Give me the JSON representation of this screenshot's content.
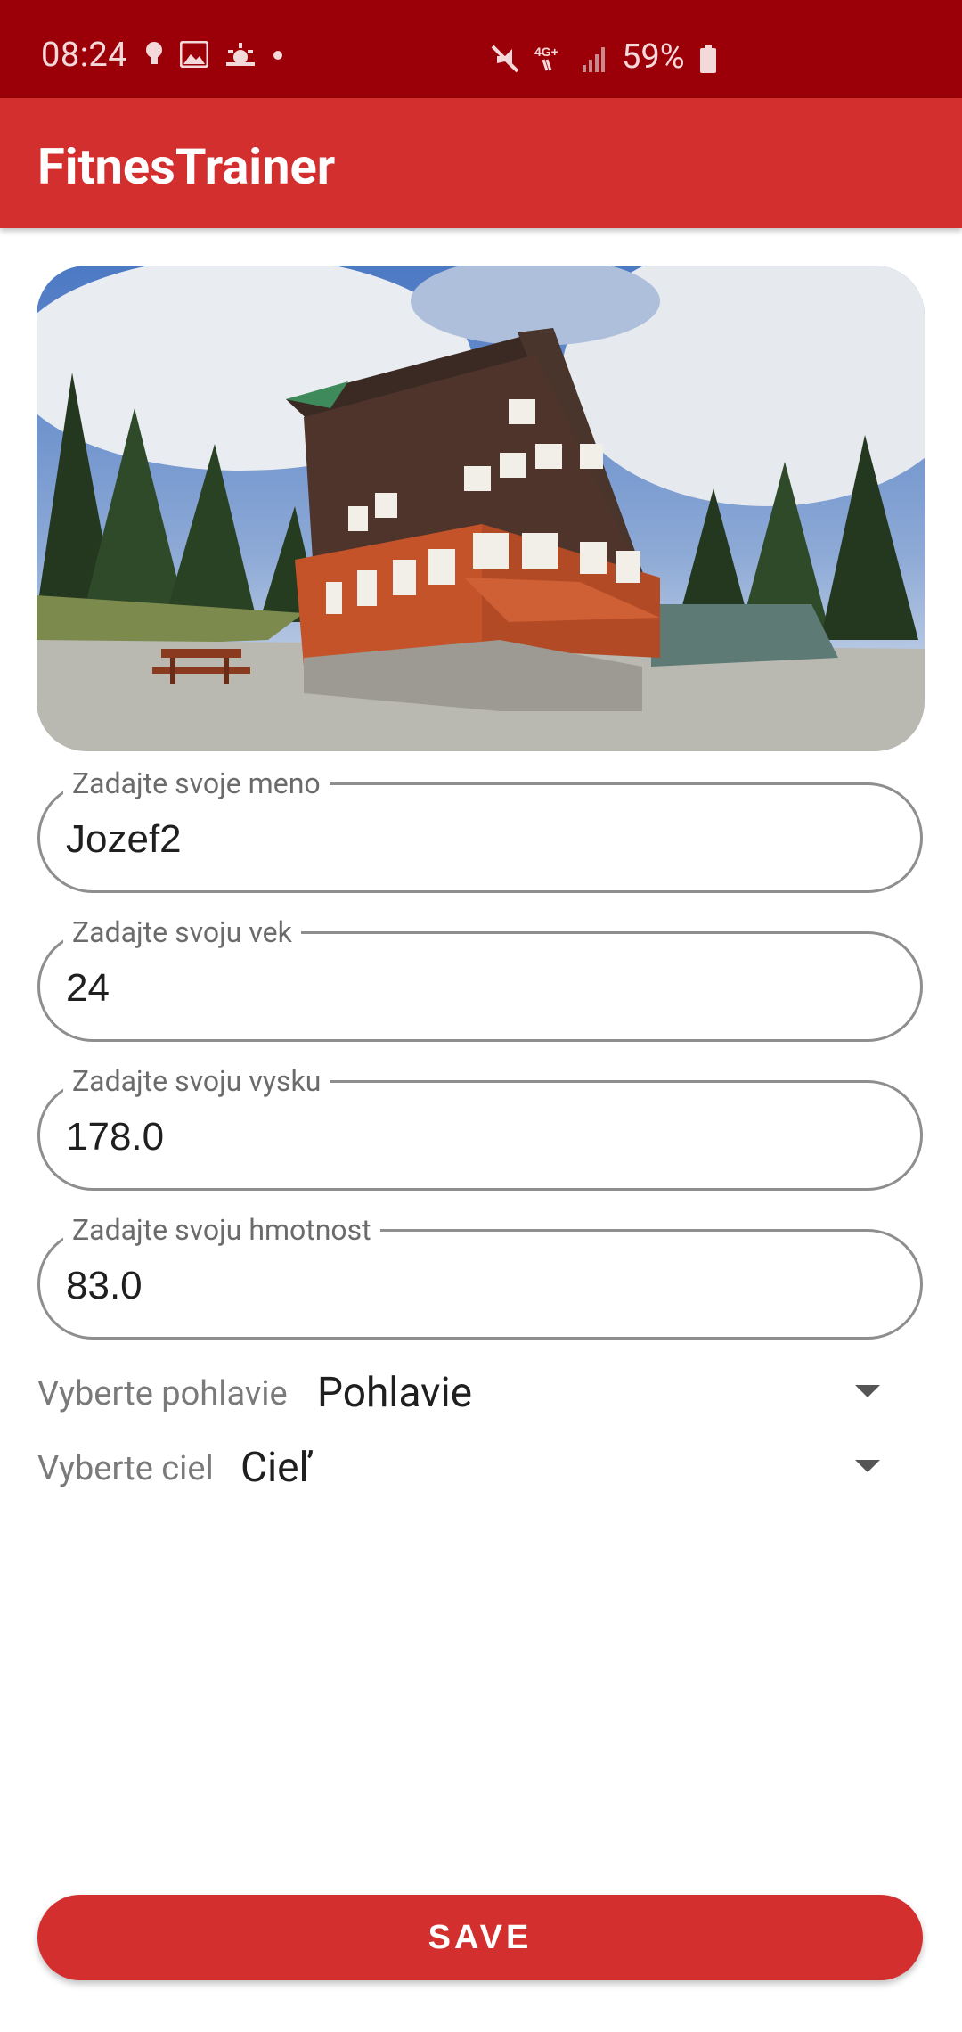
{
  "status_bar": {
    "time": "08:24",
    "battery": "59%",
    "icons_left": [
      "bulb-icon",
      "image-icon",
      "weather-icon",
      "dot-icon"
    ],
    "icons_right": [
      "mute-icon",
      "4g-icon",
      "signal-icon",
      "battery-icon"
    ]
  },
  "app_bar": {
    "title": "FitnesTrainer",
    "color": "#d32f2f"
  },
  "form": {
    "name": {
      "label": "Zadajte svoje meno",
      "value": "Jozef2"
    },
    "age": {
      "label": "Zadajte svoju vek",
      "value": "24"
    },
    "height": {
      "label": "Zadajte svoju vysku",
      "value": "178.0"
    },
    "weight": {
      "label": "Zadajte svoju hmotnost",
      "value": "83.0"
    },
    "gender": {
      "label": "Vyberte pohlavie",
      "selected": "Pohlavie"
    },
    "goal": {
      "label": "Vyberte ciel",
      "selected": "Cieľ"
    }
  },
  "save_button": {
    "label": "SAVE"
  }
}
